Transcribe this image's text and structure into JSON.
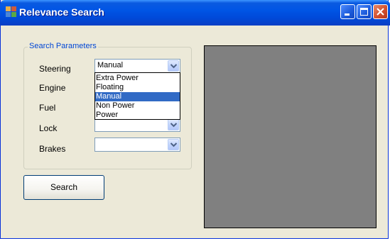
{
  "window": {
    "title": "Relevance Search",
    "icon": "application-icon",
    "controls": [
      "minimize-icon",
      "maximize-icon",
      "close-icon"
    ]
  },
  "group": {
    "legend": "Search Parameters"
  },
  "fields": [
    {
      "label": "Steering",
      "value": "Manual"
    },
    {
      "label": "Engine",
      "value": ""
    },
    {
      "label": "Fuel",
      "value": ""
    },
    {
      "label": "Lock",
      "value": ""
    },
    {
      "label": "Brakes",
      "value": ""
    }
  ],
  "steering_dropdown": {
    "options": [
      "Extra Power",
      "Floating",
      "Manual",
      "Non Power",
      "Power"
    ],
    "selected": "Manual"
  },
  "search_button": {
    "label": "Search"
  },
  "colors": {
    "titlebar": "#0055e5",
    "window_bg": "#ece9d8",
    "selection": "#316ac5",
    "preview_panel": "#808080",
    "group_legend": "#0046d5"
  }
}
